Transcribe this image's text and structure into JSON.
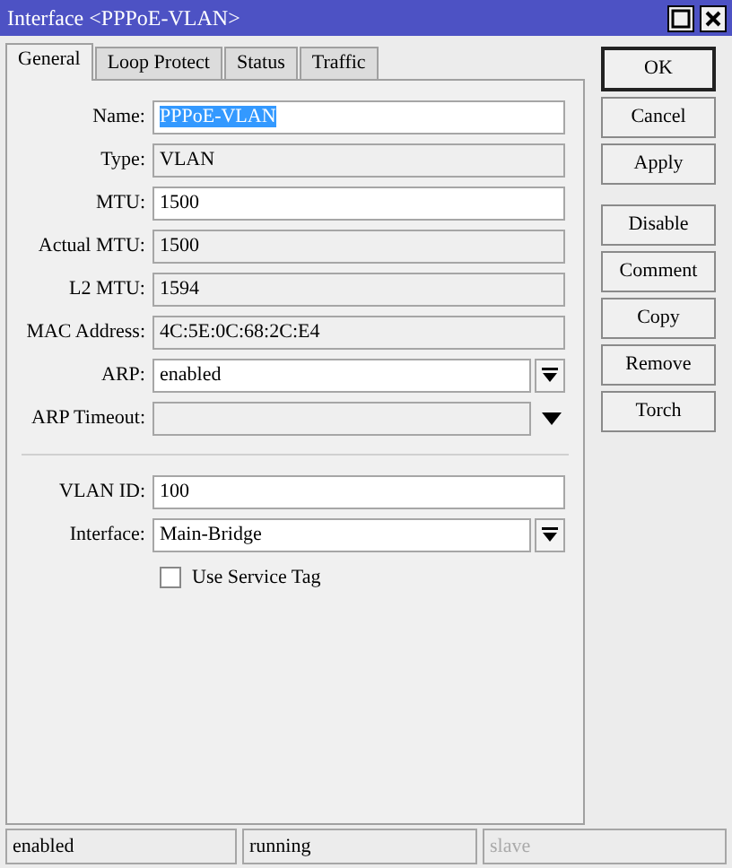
{
  "window": {
    "title": "Interface <PPPoE-VLAN>"
  },
  "tabs": [
    {
      "label": "General",
      "selected": true
    },
    {
      "label": "Loop Protect",
      "selected": false
    },
    {
      "label": "Status",
      "selected": false
    },
    {
      "label": "Traffic",
      "selected": false
    }
  ],
  "fields": [
    {
      "label": "Name:",
      "value": "PPPoE-VLAN",
      "kind": "text",
      "highlighted": true
    },
    {
      "label": "Type:",
      "value": "VLAN",
      "kind": "readonly"
    },
    {
      "label": "MTU:",
      "value": "1500",
      "kind": "text"
    },
    {
      "label": "Actual MTU:",
      "value": "1500",
      "kind": "readonly"
    },
    {
      "label": "L2 MTU:",
      "value": "1594",
      "kind": "readonly"
    },
    {
      "label": "MAC Address:",
      "value": "4C:5E:0C:68:2C:E4",
      "kind": "readonly"
    },
    {
      "label": "ARP:",
      "value": "enabled",
      "kind": "select"
    },
    {
      "label": "ARP Timeout:",
      "kind": "unset-select"
    },
    {
      "kind": "separator"
    },
    {
      "label": "VLAN ID:",
      "value": "100",
      "kind": "text"
    },
    {
      "label": "Interface:",
      "value": "Main-Bridge",
      "kind": "select"
    },
    {
      "label": "Use Service Tag",
      "kind": "checkbox",
      "checked": false
    }
  ],
  "button_groups": [
    [
      {
        "label": "OK",
        "default": true
      },
      {
        "label": "Cancel",
        "default": false
      },
      {
        "label": "Apply",
        "default": false
      }
    ],
    [
      {
        "label": "Disable",
        "default": false
      },
      {
        "label": "Comment",
        "default": false
      },
      {
        "label": "Copy",
        "default": false
      },
      {
        "label": "Remove",
        "default": false
      },
      {
        "label": "Torch",
        "default": false
      }
    ]
  ],
  "status_bar": [
    {
      "text": "enabled",
      "disabled": false
    },
    {
      "text": "running",
      "disabled": false
    },
    {
      "text": "slave",
      "disabled": true
    }
  ]
}
